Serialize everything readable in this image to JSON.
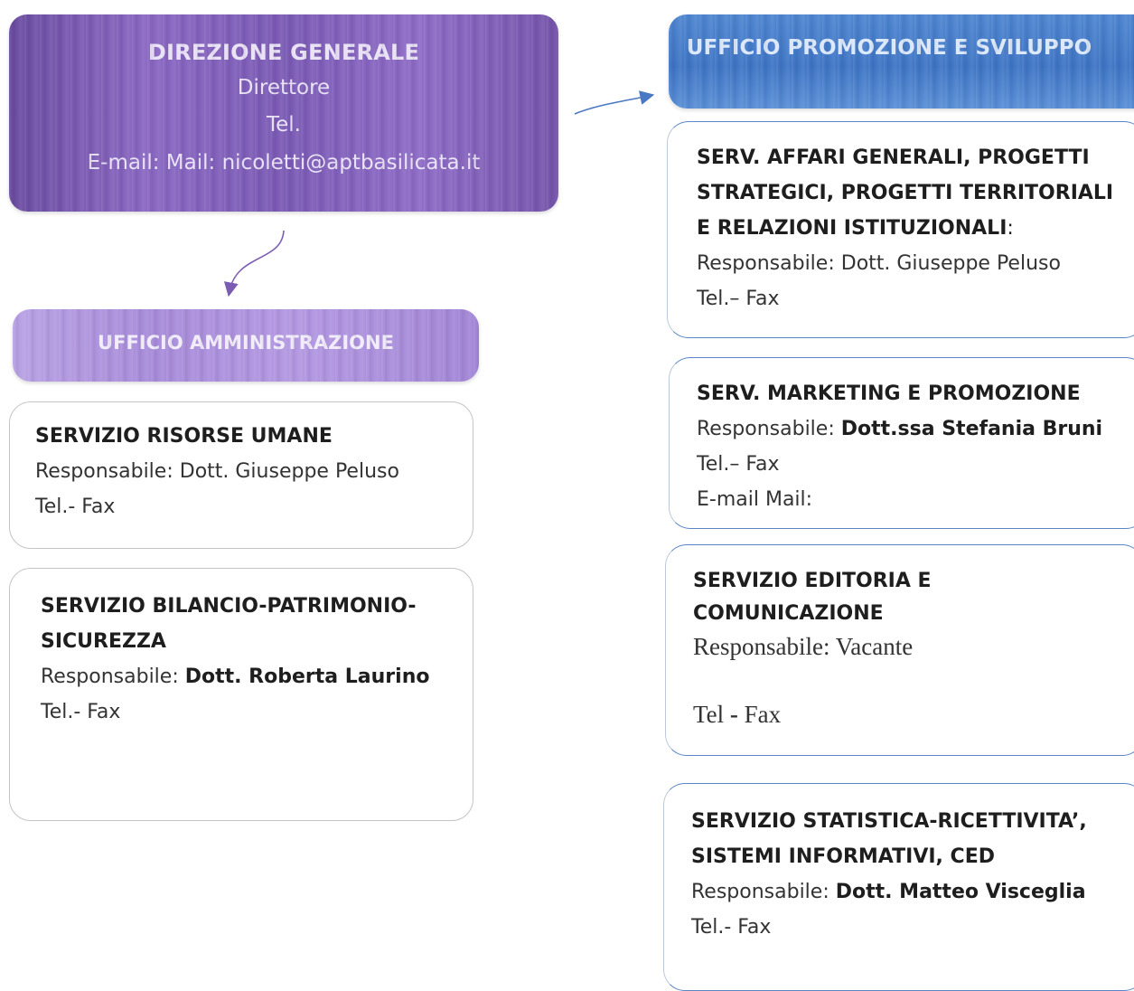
{
  "direzione": {
    "title": "DIREZIONE GENERALE",
    "line1": "Direttore",
    "line2": "Tel.",
    "line3": "E-mail: Mail: nicoletti@aptbasilicata.it"
  },
  "ufficio_amministrazione": {
    "title": "UFFICIO AMMINISTRAZIONE",
    "services": [
      {
        "title": "SERVIZIO RISORSE UMANE",
        "resp_label": "Responsabile: ",
        "resp_name": "Dott. Giuseppe Peluso",
        "tel": "Tel.- Fax"
      },
      {
        "title_line1": "SERVIZIO BILANCIO-PATRIMONIO-",
        "title_line2": "SICUREZZA",
        "resp_label": "Responsabile: ",
        "resp_name": "Dott. Roberta Laurino",
        "tel": "Tel.- Fax"
      }
    ]
  },
  "ufficio_promozione": {
    "title": "UFFICIO PROMOZIONE E SVILUPPO",
    "services": [
      {
        "title_line1": "SERV. AFFARI GENERALI, PROGETTI",
        "title_line2": "STRATEGICI, PROGETTI TERRITORIALI",
        "title_line3": "E RELAZIONI ISTITUZIONALI",
        "title_suffix": ":",
        "resp_label": "Responsabile: ",
        "resp_name": "Dott. Giuseppe Peluso",
        "tel": "Tel.– Fax"
      },
      {
        "title": "SERV. MARKETING E PROMOZIONE",
        "resp_label": "Responsabile: ",
        "resp_name": "Dott.ssa Stefania Bruni",
        "tel": "Tel.– Fax",
        "email": "E-mail Mail:"
      },
      {
        "title_line1": "SERVIZIO EDITORIA E",
        "title_line2": "COMUNICAZIONE",
        "resp": "Responsabile: Vacante",
        "tel_label": "Tel ",
        "tel_dash": "-",
        "tel_fax": " Fax"
      },
      {
        "title_line1": "SERVIZIO STATISTICA-RICETTIVITA’,",
        "title_line2": "SISTEMI INFORMATIVI, CED",
        "resp_label": "Responsabile: ",
        "resp_name": "Dott. Matteo Visceglia",
        "tel": "Tel.- Fax"
      }
    ]
  }
}
